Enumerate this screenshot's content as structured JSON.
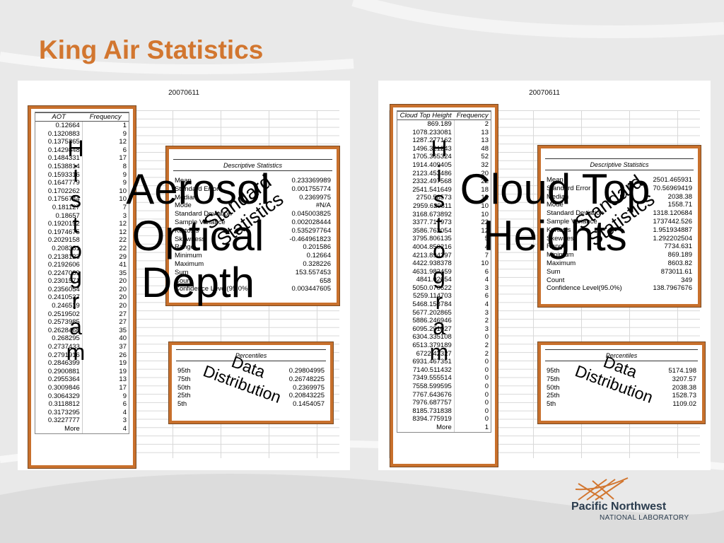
{
  "slide": {
    "title": "King Air Statistics",
    "accent_color": "#d2762f",
    "box_border_color": "#c8702c"
  },
  "left": {
    "date": "20070611",
    "histogram": {
      "headers": [
        "AOT",
        "Frequency"
      ],
      "rows": [
        [
          "0.12664",
          "1"
        ],
        [
          "0.1320883",
          "9"
        ],
        [
          "0.1375365",
          "12"
        ],
        [
          "0.1429848",
          "6"
        ],
        [
          "0.1484331",
          "17"
        ],
        [
          "0.1538814",
          "8"
        ],
        [
          "0.1593316",
          "9"
        ],
        [
          "0.1647779",
          "9"
        ],
        [
          "0.1702262",
          "10"
        ],
        [
          "0.1756744",
          "10"
        ],
        [
          "0.181127",
          "7"
        ],
        [
          "0.18657",
          "3"
        ],
        [
          "0.1920192",
          "12"
        ],
        [
          "0.1974675",
          "12"
        ],
        [
          "0.2029158",
          "22"
        ],
        [
          "0.208361",
          "22"
        ],
        [
          "0.2138123",
          "29"
        ],
        [
          "0.2192606",
          "41"
        ],
        [
          "0.2247089",
          "35"
        ],
        [
          "0.2301571",
          "20"
        ],
        [
          "0.2356054",
          "20"
        ],
        [
          "0.2410537",
          "20"
        ],
        [
          "0.246519",
          "20"
        ],
        [
          "0.2519502",
          "27"
        ],
        [
          "0.2573985",
          "27"
        ],
        [
          "0.2628468",
          "35"
        ],
        [
          "0.268295",
          "40"
        ],
        [
          "0.2737433",
          "37"
        ],
        [
          "0.2791916",
          "26"
        ],
        [
          "0.2846399",
          "19"
        ],
        [
          "0.2900881",
          "19"
        ],
        [
          "0.2955364",
          "13"
        ],
        [
          "0.3009846",
          "17"
        ],
        [
          "0.3064329",
          "9"
        ],
        [
          "0.3118812",
          "6"
        ],
        [
          "0.3173295",
          "4"
        ],
        [
          "0.3227777",
          "3"
        ],
        [
          "More",
          "4"
        ]
      ]
    },
    "stats": {
      "header": "Descriptive Statistics",
      "rows": [
        [
          "Mean",
          "0.233369989"
        ],
        [
          "Standard Error",
          "0.001755774"
        ],
        [
          "Median",
          "0.2369975"
        ],
        [
          "Mode",
          "#N/A"
        ],
        [
          "Standard Deviation",
          "0.045003825"
        ],
        [
          "Sample Variance",
          "0.002028444"
        ],
        [
          "Kurtosis",
          "0.535297764"
        ],
        [
          "Skewness",
          "-0.464961823"
        ],
        [
          "Range",
          "0.201586"
        ],
        [
          "Minimum",
          "0.12664"
        ],
        [
          "Maximum",
          "0.328226"
        ],
        [
          "Sum",
          "153.557453"
        ],
        [
          "Count",
          "658"
        ],
        [
          "Confidence Level(95.0%)",
          "0.003447605"
        ]
      ]
    },
    "percentiles": {
      "header": "Percentiles",
      "rows": [
        [
          "95th",
          "0.29804995"
        ],
        [
          "75th",
          "0.26748225"
        ],
        [
          "50th",
          "0.2369975"
        ],
        [
          "25th",
          "0.20843225"
        ],
        [
          "5th",
          "0.1454057"
        ]
      ]
    },
    "overlay_big": "Aerosol Optical Depth",
    "overlay_vertical": "Histogram",
    "overlay_stats": "Standard Statistics",
    "overlay_pct": "Data Distribution"
  },
  "right": {
    "date": "20070611",
    "histogram": {
      "headers": [
        "Cloud Top Height",
        "Frequency"
      ],
      "rows": [
        [
          "869.189",
          "2"
        ],
        [
          "1078.233081",
          "13"
        ],
        [
          "1287.277162",
          "13"
        ],
        [
          "1496.321243",
          "48"
        ],
        [
          "1705.365324",
          "52"
        ],
        [
          "1914.409405",
          "32"
        ],
        [
          "2123.453486",
          "20"
        ],
        [
          "2332.497568",
          "22"
        ],
        [
          "2541.541649",
          "18"
        ],
        [
          "2750.58573",
          "12"
        ],
        [
          "2959.629811",
          "10"
        ],
        [
          "3168.673892",
          "10"
        ],
        [
          "3377.717973",
          "22"
        ],
        [
          "3586.762054",
          "12"
        ],
        [
          "3795.806135",
          "5"
        ],
        [
          "4004.850216",
          "4"
        ],
        [
          "4213.894297",
          "7"
        ],
        [
          "4422.938378",
          "10"
        ],
        [
          "4631.982459",
          "6"
        ],
        [
          "4841.02654",
          "4"
        ],
        [
          "5050.070622",
          "3"
        ],
        [
          "5259.114703",
          "6"
        ],
        [
          "5468.158784",
          "4"
        ],
        [
          "5677.202865",
          "3"
        ],
        [
          "5886.246946",
          "2"
        ],
        [
          "6095.291027",
          "3"
        ],
        [
          "6304.335108",
          "0"
        ],
        [
          "6513.379189",
          "2"
        ],
        [
          "6722.42327",
          "2"
        ],
        [
          "6931.467351",
          "0"
        ],
        [
          "7140.511432",
          "0"
        ],
        [
          "7349.555514",
          "0"
        ],
        [
          "7558.599595",
          "0"
        ],
        [
          "7767.643676",
          "0"
        ],
        [
          "7976.687757",
          "0"
        ],
        [
          "8185.731838",
          "0"
        ],
        [
          "8394.775919",
          "0"
        ],
        [
          "More",
          "1"
        ]
      ]
    },
    "stats": {
      "header": "Descriptive Statistics",
      "rows": [
        [
          "Mean",
          "2501.465931"
        ],
        [
          "Standard Error",
          "70.56969419"
        ],
        [
          "Median",
          "2038.38"
        ],
        [
          "Mode",
          "1558.71"
        ],
        [
          "Standard Deviation",
          "1318.120684"
        ],
        [
          "Sample Variance",
          "1737442.526"
        ],
        [
          "Kurtosis",
          "1.951934887"
        ],
        [
          "Skewness",
          "1.292202504"
        ],
        [
          "Range",
          "7734.631"
        ],
        [
          "Minimum",
          "869.189"
        ],
        [
          "Maximum",
          "8603.82"
        ],
        [
          "Sum",
          "873011.61"
        ],
        [
          "Count",
          "349"
        ],
        [
          "Confidence Level(95.0%)",
          "138.7967676"
        ]
      ]
    },
    "percentiles": {
      "header": "Percentiles",
      "rows": [
        [
          "95th",
          "5174.198"
        ],
        [
          "75th",
          "3207.57"
        ],
        [
          "50th",
          "2038.38"
        ],
        [
          "25th",
          "1528.73"
        ],
        [
          "5th",
          "1109.02"
        ]
      ]
    },
    "overlay_big": "Cloud Top Heights",
    "overlay_vertical": "Histogram",
    "overlay_stats": "Standard Statistics",
    "overlay_pct": "Data Distribution"
  },
  "logo": {
    "name": "Pacific Northwest",
    "sub": "NATIONAL LABORATORY",
    "color": "#2a3c4e",
    "mark_color": "#d2762f"
  }
}
